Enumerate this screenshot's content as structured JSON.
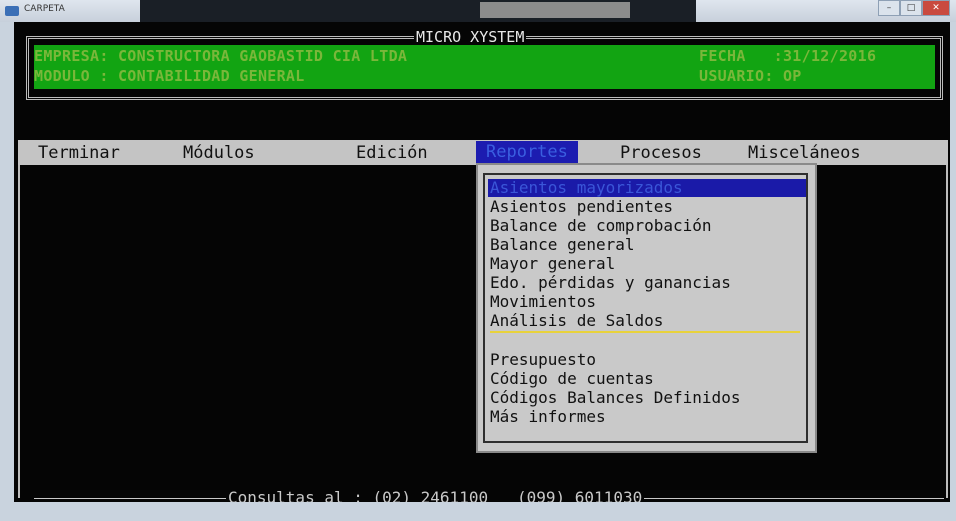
{
  "window": {
    "title": "CARPETA",
    "buttons": {
      "minimize": "–",
      "maximize": "□",
      "close": "✕"
    }
  },
  "header": {
    "title": "MICRO XYSTEM",
    "empresa": "EMPRESA: CONSTRUCTORA GAOBASTID CIA LTDA",
    "fecha": "FECHA   :31/12/2016",
    "modulo": "MODULO : CONTABILIDAD GENERAL",
    "usuario": "USUARIO: OP"
  },
  "menu": {
    "items": [
      "Terminar",
      "Módulos",
      "Edición",
      "Reportes",
      "Procesos",
      "Misceláneos"
    ],
    "active": "Reportes"
  },
  "dropdown": {
    "group1": [
      "Asientos mayorizados",
      "Asientos pendientes",
      "Balance de comprobación",
      "Balance general",
      "Mayor general",
      "Edo. pérdidas y ganancias",
      "Movimientos",
      "Análisis de Saldos"
    ],
    "group2": [
      "Presupuesto",
      "Código de cuentas",
      "Códigos Balances Definidos",
      "Más informes"
    ],
    "selected": "Asientos mayorizados"
  },
  "footer": {
    "text": "Consultas al : (02) 2461100   (099) 6011030"
  }
}
